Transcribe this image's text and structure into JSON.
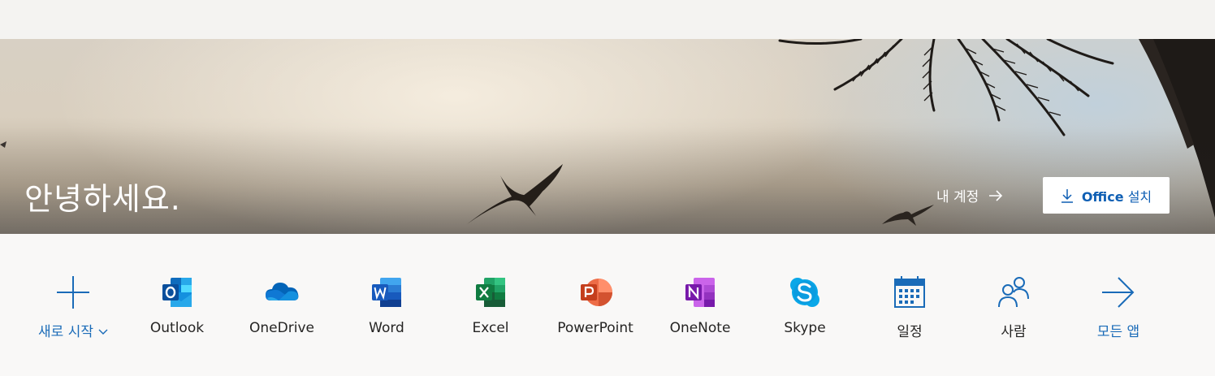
{
  "hero": {
    "greeting": "안녕하세요.",
    "account_link": "내 계정",
    "install_button": {
      "prefix": "Office",
      "suffix": "설치"
    }
  },
  "apps": [
    {
      "label": "새로 시작",
      "icon": "plus-icon"
    },
    {
      "label": "Outlook",
      "icon": "outlook-icon"
    },
    {
      "label": "OneDrive",
      "icon": "onedrive-icon"
    },
    {
      "label": "Word",
      "icon": "word-icon"
    },
    {
      "label": "Excel",
      "icon": "excel-icon"
    },
    {
      "label": "PowerPoint",
      "icon": "powerpoint-icon"
    },
    {
      "label": "OneNote",
      "icon": "onenote-icon"
    },
    {
      "label": "Skype",
      "icon": "skype-icon"
    },
    {
      "label": "일정",
      "icon": "calendar-icon"
    },
    {
      "label": "사람",
      "icon": "people-icon"
    },
    {
      "label": "모든 앱",
      "icon": "arrow-right-icon"
    }
  ],
  "colors": {
    "accent": "#1a6bb8",
    "outlook": "#0f6cbd",
    "onedrive": "#1d7fd6",
    "word": "#2b65c8",
    "excel": "#1d7a45",
    "powerpoint": "#d24726",
    "onenote": "#7c2fb8",
    "skype": "#0aa7e8"
  }
}
